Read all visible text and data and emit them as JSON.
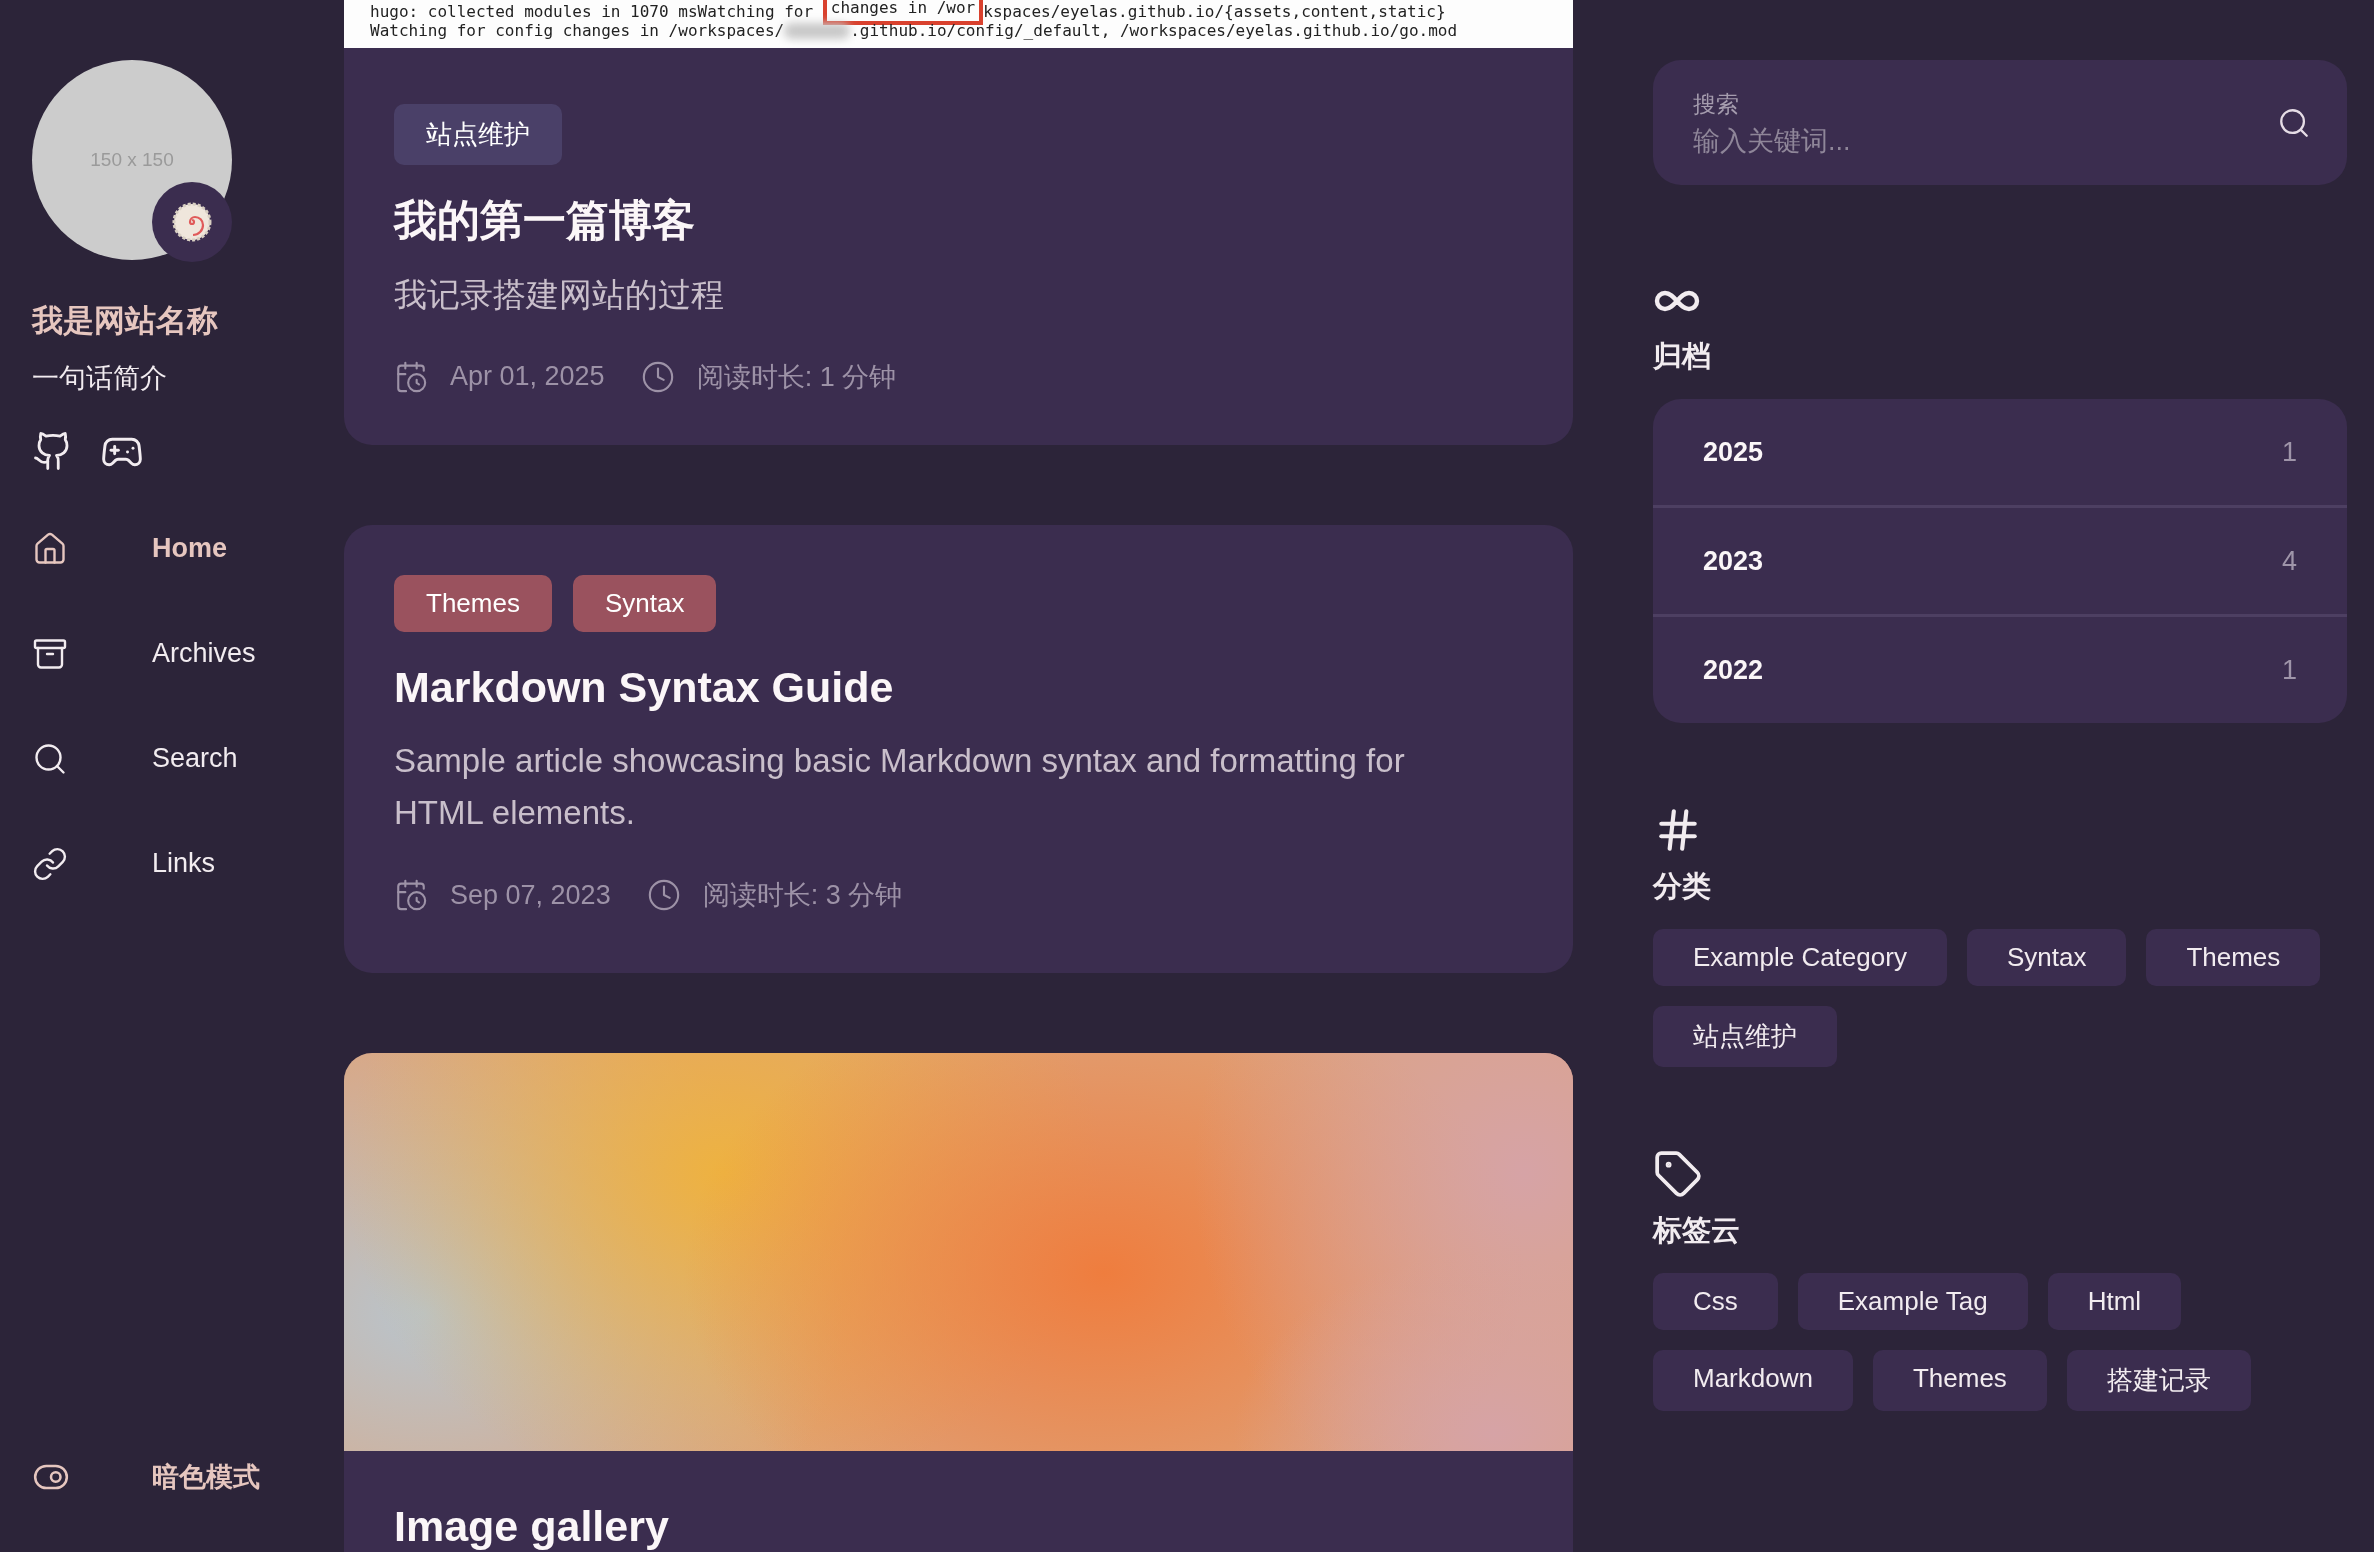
{
  "sidebar": {
    "avatar_placeholder": "150 x 150",
    "site_name": "我是网站名称",
    "tagline": "一句话简介",
    "menu": [
      {
        "label": "Home",
        "selected": true
      },
      {
        "label": "Archives",
        "selected": false
      },
      {
        "label": "Search",
        "selected": false
      },
      {
        "label": "Links",
        "selected": false
      }
    ],
    "dark_mode": {
      "label": "暗色模式"
    }
  },
  "posts": [
    {
      "kind": "screenshot",
      "terminal_lines": [
        [
          "hugo: collected modules in 1070 msWatching for ",
          "changes in /wor",
          "kspaces/eyelas.github.io/{assets,content,static}"
        ],
        [
          "Watching for config changes in /workspaces/",
          ".github.io/config/_default, /workspaces/eyelas.github.io/go.mod"
        ]
      ],
      "categories": [
        {
          "label": "站点维护",
          "color": "#4a4068"
        }
      ],
      "title": "我的第一篇博客",
      "description": "我记录搭建网站的过程",
      "date": "Apr 01, 2025",
      "reading_time": "阅读时长: 1 分钟"
    },
    {
      "kind": "plain",
      "categories": [
        {
          "label": "Themes",
          "color": "#9a525e"
        },
        {
          "label": "Syntax",
          "color": "#9a525e"
        }
      ],
      "title": "Markdown Syntax Guide",
      "description": "Sample article showcasing basic Markdown syntax and formatting for HTML elements.",
      "date": "Sep 07, 2023",
      "reading_time": "阅读时长: 3 分钟"
    },
    {
      "kind": "picture",
      "title": "Image gallery"
    }
  ],
  "search": {
    "label": "搜索",
    "placeholder": "输入关键词..."
  },
  "archives": {
    "title": "归档",
    "years": [
      {
        "year": "2025",
        "count": "1"
      },
      {
        "year": "2023",
        "count": "4"
      },
      {
        "year": "2022",
        "count": "1"
      }
    ]
  },
  "categories": {
    "title": "分类",
    "items": [
      "Example Category",
      "Syntax",
      "Themes",
      "站点维护"
    ]
  },
  "tag_cloud": {
    "title": "标签云",
    "items": [
      "Css",
      "Example Tag",
      "Html",
      "Markdown",
      "Themes",
      "搭建记录"
    ]
  }
}
